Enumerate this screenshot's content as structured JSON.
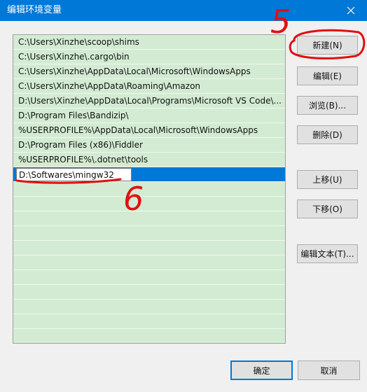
{
  "window": {
    "title": "编辑环境变量"
  },
  "list": {
    "items": [
      "C:\\Users\\Xinzhe\\scoop\\shims",
      "C:\\Users\\Xinzhe\\.cargo\\bin",
      "C:\\Users\\Xinzhe\\AppData\\Local\\Microsoft\\WindowsApps",
      "C:\\Users\\Xinzhe\\AppData\\Roaming\\Amazon",
      "D:\\Users\\Xinzhe\\AppData\\Local\\Programs\\Microsoft VS Code\\...",
      "D:\\Program Files\\Bandizip\\",
      "%USERPROFILE%\\AppData\\Local\\Microsoft\\WindowsApps",
      "D:\\Program Files (x86)\\Fiddler",
      "%USERPROFILE%\\.dotnet\\tools"
    ],
    "editing_value": "D:\\Softwares\\mingw32"
  },
  "buttons": {
    "new": "新建(N)",
    "edit": "编辑(E)",
    "browse": "浏览(B)...",
    "delete": "删除(D)",
    "move_up": "上移(U)",
    "move_down": "下移(O)",
    "edit_text": "编辑文本(T)...",
    "ok": "确定",
    "cancel": "取消"
  },
  "annotations": {
    "step_new": "5",
    "step_edit": "6"
  },
  "colors": {
    "titlebar": "#0078d7",
    "list_background": "#d3ebd3",
    "selection": "#0078d7",
    "annotation": "#e01010"
  }
}
